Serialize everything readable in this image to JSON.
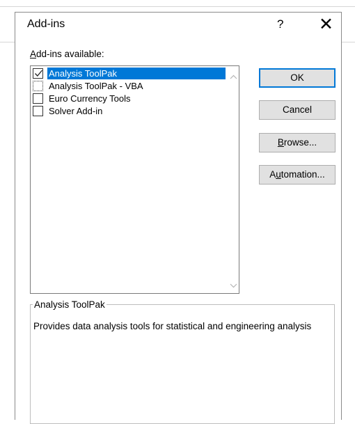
{
  "dialog": {
    "title": "Add-ins",
    "help_label": "?",
    "close_label": "✕"
  },
  "available": {
    "label_underlined": "A",
    "label_rest": "dd-ins available:",
    "items": [
      {
        "label": "Analysis ToolPak",
        "checked": true,
        "selected": true
      },
      {
        "label": "Analysis ToolPak - VBA",
        "checked": false,
        "selected": false
      },
      {
        "label": "Euro Currency Tools",
        "checked": false,
        "selected": false
      },
      {
        "label": "Solver Add-in",
        "checked": false,
        "selected": false
      }
    ]
  },
  "buttons": {
    "ok": "OK",
    "cancel": "Cancel",
    "browse_underlined": "B",
    "browse_rest": "rowse...",
    "automation_pre": "A",
    "automation_underlined": "u",
    "automation_rest": "tomation..."
  },
  "description": {
    "title": "Analysis ToolPak",
    "text": "Provides data analysis tools for statistical and engineering analysis"
  },
  "colors": {
    "selection": "#0078d7",
    "default_button_border": "#0078d7"
  }
}
